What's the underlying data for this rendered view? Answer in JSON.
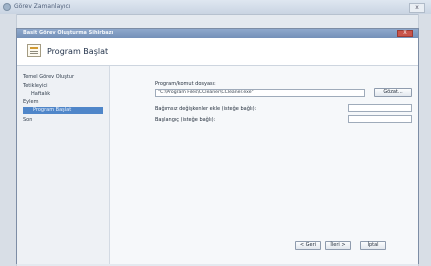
{
  "background_window": {
    "title": "Görev Zamanlayıcı",
    "close_label": "x"
  },
  "dialog": {
    "title": "Basit Görev Oluşturma Sihirbazı",
    "close_label": "X",
    "header_title": "Program Başlat",
    "steps": {
      "s1": "Temel Görev Oluştur",
      "s2": "Tetikleyici",
      "s3": "Haftalık",
      "s4": "Eylem",
      "s5": "Program Başlat",
      "s6": "Son"
    },
    "program_label": "Program/komut dosyası:",
    "program_value": "\"C:\\Program Files\\CCleaner\\CCleaner.exe\"",
    "browse_label": "Gözat...",
    "args_label": "Bağımsız değişkenler ekle (isteğe bağlı):",
    "args_value": "",
    "startin_label": "Başlangıç (isteğe bağlı):",
    "startin_value": "",
    "back_label": "< Geri",
    "next_label": "İleri >",
    "cancel_label": "İptal"
  }
}
